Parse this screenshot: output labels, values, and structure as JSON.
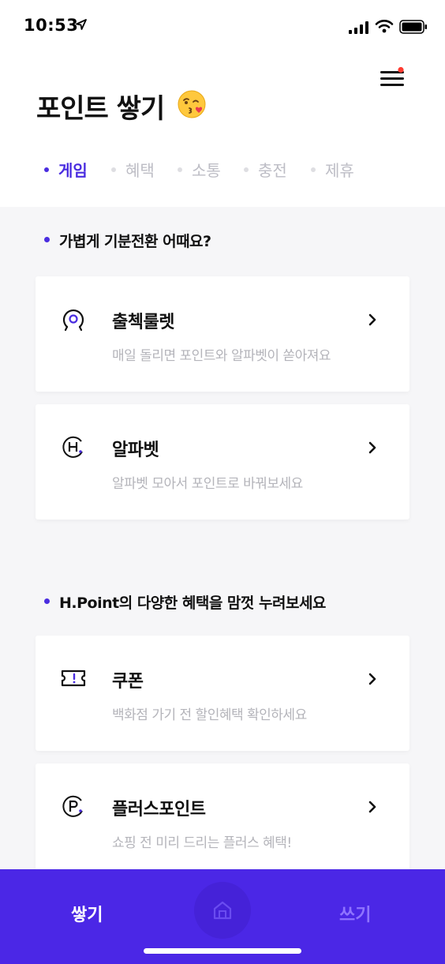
{
  "status": {
    "time": "10:53"
  },
  "header": {
    "title": "포인트 쌓기"
  },
  "tabs": [
    {
      "label": "게임",
      "active": true
    },
    {
      "label": "혜택",
      "active": false
    },
    {
      "label": "소통",
      "active": false
    },
    {
      "label": "충전",
      "active": false
    },
    {
      "label": "제휴",
      "active": false
    }
  ],
  "sections": [
    {
      "heading": "가볍게 기분전환 어때요?",
      "cards": [
        {
          "title": "출첵룰렛",
          "subtitle": "매일 돌리면 포인트와 알파벳이 쏟아져요",
          "icon": "roulette-icon"
        },
        {
          "title": "알파벳",
          "subtitle": "알파벳 모아서 포인트로 바꿔보세요",
          "icon": "h-circle-icon"
        }
      ]
    },
    {
      "heading": "H.Point의 다양한 혜택을 맘껏 누려보세요",
      "cards": [
        {
          "title": "쿠폰",
          "subtitle": "백화점 가기 전 할인혜택 확인하세요",
          "icon": "ticket-icon"
        },
        {
          "title": "플러스포인트",
          "subtitle": "쇼핑 전 미리 드리는 플러스 혜택!",
          "icon": "p-circle-icon"
        }
      ]
    }
  ],
  "bottom_nav": {
    "left_label": "쌓기",
    "right_label": "쓰기",
    "center_icon": "home-icon"
  },
  "colors": {
    "accent": "#4a2de0",
    "nav_bg": "#4b27e6",
    "notification": "#ff3b30"
  }
}
